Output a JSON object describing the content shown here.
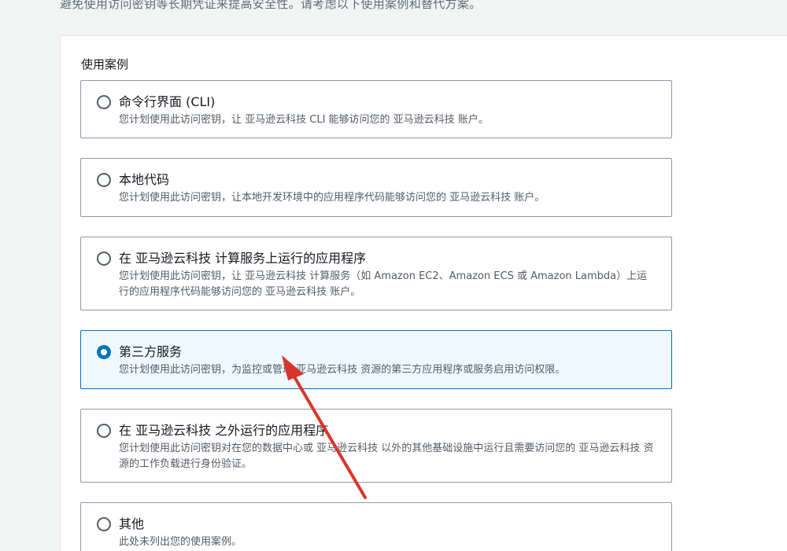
{
  "intro_text": "避免使用访问密钥等长期凭证来提高安全性。请考虑以下使用案例和替代方案。",
  "section_label": "使用案例",
  "options": [
    {
      "title": "命令行界面 (CLI)",
      "description": "您计划使用此访问密钥，让 亚马逊云科技 CLI 能够访问您的 亚马逊云科技 账户。",
      "selected": false
    },
    {
      "title": "本地代码",
      "description": "您计划使用此访问密钥，让本地开发环境中的应用程序代码能够访问您的 亚马逊云科技 账户。",
      "selected": false
    },
    {
      "title": "在 亚马逊云科技 计算服务上运行的应用程序",
      "description": "您计划使用此访问密钥，让 亚马逊云科技 计算服务（如 Amazon EC2、Amazon ECS 或 Amazon Lambda）上运行的应用程序代码能够访问您的 亚马逊云科技 账户。",
      "selected": false
    },
    {
      "title": "第三方服务",
      "description": "您计划使用此访问密钥，为监控或管理 亚马逊云科技 资源的第三方应用程序或服务启用访问权限。",
      "selected": true
    },
    {
      "title": "在 亚马逊云科技 之外运行的应用程序",
      "description": "您计划使用此访问密钥对在您的数据中心或 亚马逊云科技 以外的其他基础设施中运行且需要访问您的 亚马逊云科技 资源的工作负载进行身份验证。",
      "selected": false
    },
    {
      "title": "其他",
      "description": "此处未列出您的使用案例。",
      "selected": false
    }
  ],
  "colors": {
    "accent": "#0073bb",
    "selected_bg": "#f0f8ff",
    "annotation_arrow": "#d9342b"
  }
}
